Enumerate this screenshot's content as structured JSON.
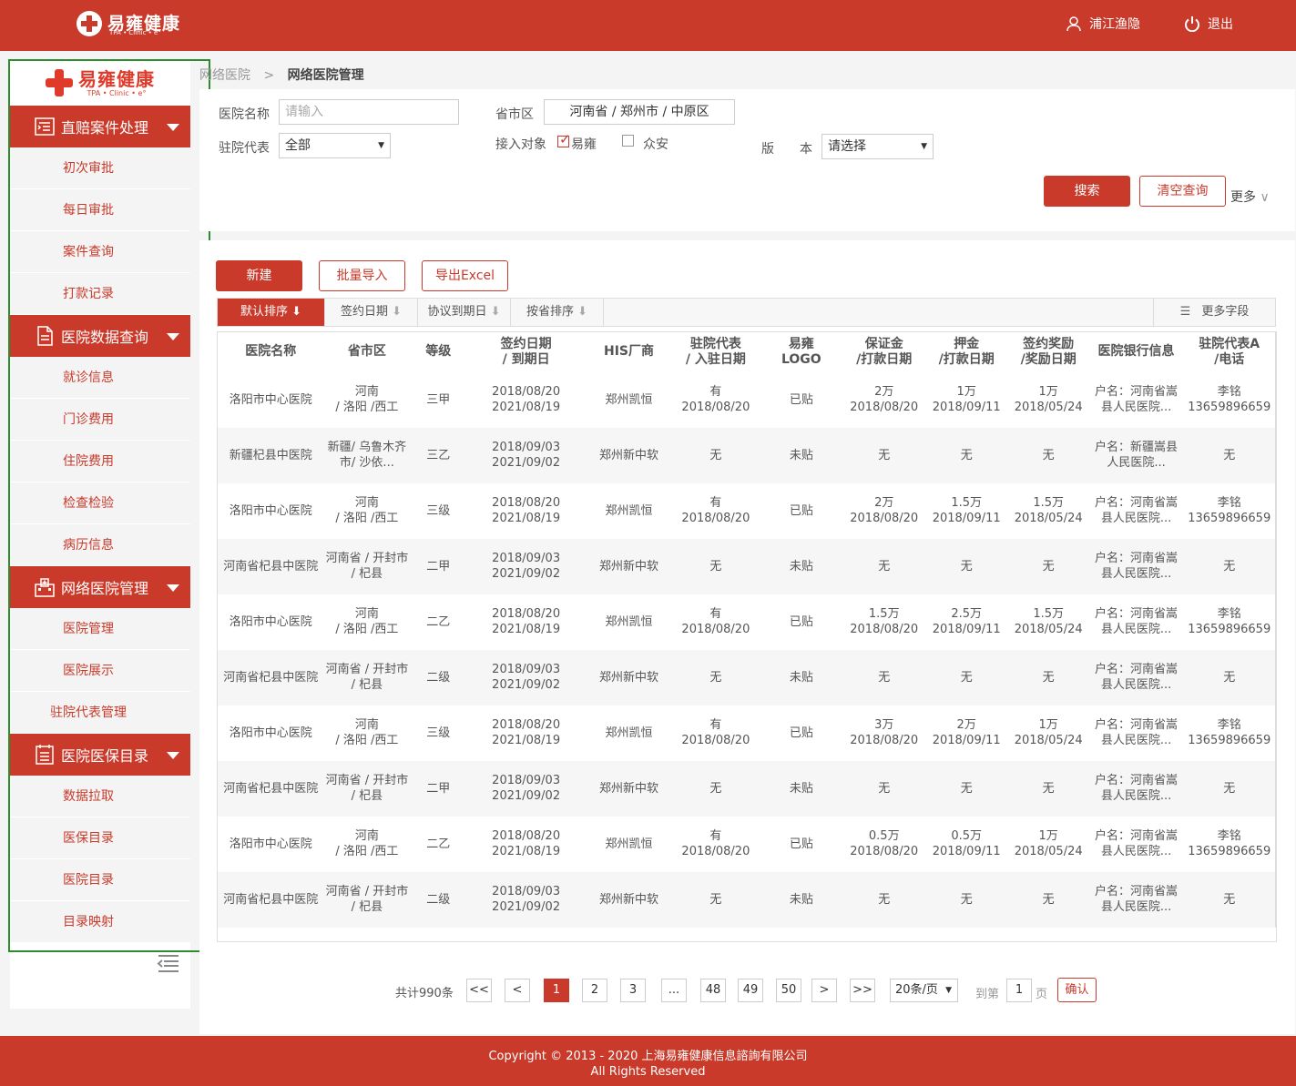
{
  "header": {
    "brand": "易雍健康",
    "brand_sub": "TPA • Clinic • e°",
    "user": "浦江渔隐",
    "logout": "退出"
  },
  "sidebar": {
    "logo": "易雍健康",
    "logo_sub": "TPA • Clinic • e°",
    "sections": [
      {
        "title": "直赔案件处理",
        "icon": "claims-icon",
        "items": [
          "初次审批",
          "每日审批",
          "案件查询",
          "打款记录"
        ]
      },
      {
        "title": "医院数据查询",
        "icon": "document-icon",
        "items": [
          "就诊信息",
          "门诊费用",
          "住院费用",
          "检查检验",
          "病历信息"
        ]
      },
      {
        "title": "网络医院管理",
        "icon": "hospital-icon",
        "items": [
          "医院管理",
          "医院展示",
          "驻院代表管理"
        ]
      },
      {
        "title": "医院医保目录",
        "icon": "list-icon",
        "items": [
          "数据拉取",
          "医保目录",
          "医院目录",
          "目录映射"
        ]
      }
    ]
  },
  "breadcrumb": {
    "parent": "网络医院",
    "sep": ">",
    "current": "网络医院管理"
  },
  "filter": {
    "hospital_label": "医院名称",
    "hospital_placeholder": "请输入",
    "region_label": "省市区",
    "region_value": "河南省 / 郑州市 / 中原区",
    "rep_label": "驻院代表",
    "rep_value": "全部",
    "target_label": "接入对象",
    "target_opt1": "易雍",
    "target_opt2": "众安",
    "version_label1": "版",
    "version_label2": "本",
    "version_value": "请选择",
    "search": "搜索",
    "clear": "清空查询",
    "more": "更多"
  },
  "actions": {
    "new": "新建",
    "batch": "批量导入",
    "export": "导出Excel"
  },
  "sorts": [
    "默认排序",
    "签约日期",
    "协议到期日",
    "按省排序"
  ],
  "more_fields": "更多字段",
  "columns": [
    "医院名称",
    "省市区",
    "等级",
    "签约日期\n/ 到期日",
    "HIS厂商",
    "驻院代表\n/ 入驻日期",
    "易雍\nLOGO",
    "保证金\n/打款日期",
    "押金\n/打款日期",
    "签约奖励\n/奖励日期",
    "医院银行信息",
    "驻院代表A\n/电话"
  ],
  "rows": [
    [
      "洛阳市中心医院",
      "河南\n/ 洛阳 /西工",
      "三甲",
      "2018/08/20\n2021/08/19",
      "郑州凯恒",
      "有\n2018/08/20",
      "已贴",
      "2万\n2018/08/20",
      "1万\n2018/09/11",
      "1万\n2018/05/24",
      "户名：河南省嵩\n县人民医院...",
      "李铭\n13659896659"
    ],
    [
      "新疆杞县中医院",
      "新疆/ 乌鲁木齐\n市/ 沙依...",
      "三乙",
      "2018/09/03\n2021/09/02",
      "郑州新中软",
      "无",
      "未贴",
      "无",
      "无",
      "无",
      "户名：新疆嵩县\n人民医院...",
      "无"
    ],
    [
      "洛阳市中心医院",
      "河南\n/ 洛阳 /西工",
      "三级",
      "2018/08/20\n2021/08/19",
      "郑州凯恒",
      "有\n2018/08/20",
      "已贴",
      "2万\n2018/08/20",
      "1.5万\n2018/09/11",
      "1.5万\n2018/05/24",
      "户名：河南省嵩\n县人民医院...",
      "李铭\n13659896659"
    ],
    [
      "河南省杞县中医院",
      "河南省 / 开封市\n/ 杞县",
      "二甲",
      "2018/09/03\n2021/09/02",
      "郑州新中软",
      "无",
      "未贴",
      "无",
      "无",
      "无",
      "户名：河南省嵩\n县人民医院...",
      "无"
    ],
    [
      "洛阳市中心医院",
      "河南\n/ 洛阳 /西工",
      "二乙",
      "2018/08/20\n2021/08/19",
      "郑州凯恒",
      "有\n2018/08/20",
      "已贴",
      "1.5万\n2018/08/20",
      "2.5万\n2018/09/11",
      "1.5万\n2018/05/24",
      "户名：河南省嵩\n县人民医院...",
      "李铭\n13659896659"
    ],
    [
      "河南省杞县中医院",
      "河南省 / 开封市\n/ 杞县",
      "二级",
      "2018/09/03\n2021/09/02",
      "郑州新中软",
      "无",
      "未贴",
      "无",
      "无",
      "无",
      "户名：河南省嵩\n县人民医院...",
      "无"
    ],
    [
      "洛阳市中心医院",
      "河南\n/ 洛阳 /西工",
      "三级",
      "2018/08/20\n2021/08/19",
      "郑州凯恒",
      "有\n2018/08/20",
      "已贴",
      "3万\n2018/08/20",
      "2万\n2018/09/11",
      "1万\n2018/05/24",
      "户名：河南省嵩\n县人民医院...",
      "李铭\n13659896659"
    ],
    [
      "河南省杞县中医院",
      "河南省 / 开封市\n/ 杞县",
      "二甲",
      "2018/09/03\n2021/09/02",
      "郑州新中软",
      "无",
      "未贴",
      "无",
      "无",
      "无",
      "户名：河南省嵩\n县人民医院...",
      "无"
    ],
    [
      "洛阳市中心医院",
      "河南\n/ 洛阳 /西工",
      "二乙",
      "2018/08/20\n2021/08/19",
      "郑州凯恒",
      "有\n2018/08/20",
      "已贴",
      "0.5万\n2018/08/20",
      "0.5万\n2018/09/11",
      "1万\n2018/05/24",
      "户名：河南省嵩\n县人民医院...",
      "李铭\n13659896659"
    ],
    [
      "河南省杞县中医院",
      "河南省 / 开封市\n/ 杞县",
      "二级",
      "2018/09/03\n2021/09/02",
      "郑州新中软",
      "无",
      "未贴",
      "无",
      "无",
      "无",
      "户名：河南省嵩\n县人民医院...",
      "无"
    ]
  ],
  "pagination": {
    "total": "共计990条",
    "first": "<<",
    "prev": "<",
    "pages": [
      "1",
      "2",
      "3",
      "...",
      "48",
      "49",
      "50"
    ],
    "current": "1",
    "next": ">",
    "last": ">>",
    "size": "20条/页",
    "goto_label": "到第",
    "goto_value": "1",
    "goto_unit": "页",
    "confirm": "确认"
  },
  "footer": {
    "line1": "Copyright © 2013 - 2020 上海易雍健康信息諮詢有限公司",
    "line2": "All Rights Reserved"
  },
  "colors": {
    "brand": "#c93a2b",
    "highlight_border": "#2e8b2e"
  }
}
